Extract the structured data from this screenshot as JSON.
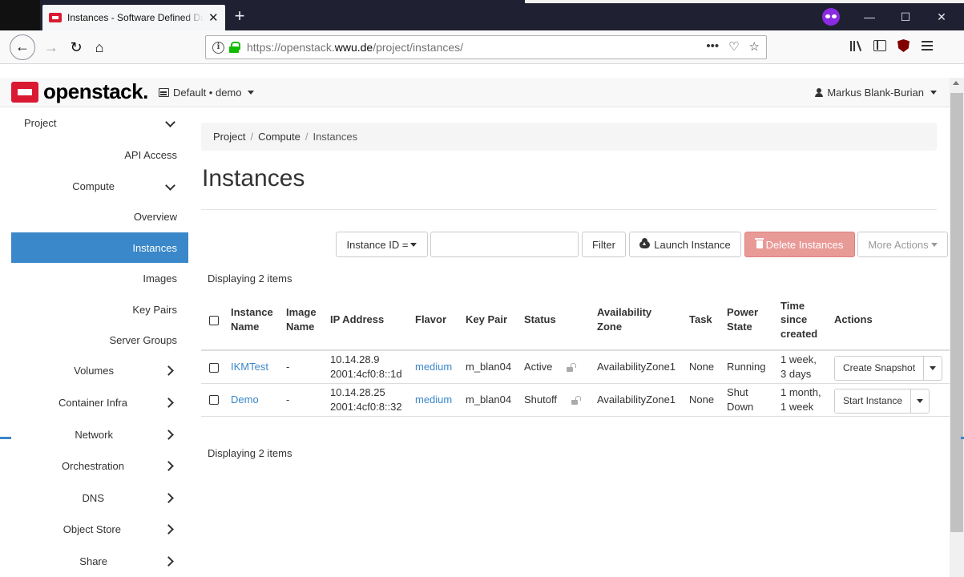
{
  "browser": {
    "tab_title": "Instances - Software Defined Datacenter",
    "tab_close": "✕",
    "new_tab": "+",
    "url_prefix": "https://openstack.",
    "url_domain": "wwu.de",
    "url_path": "/project/instances/",
    "url_more": "•••",
    "window_minimize": "—",
    "window_maximize": "☐",
    "window_close": "✕"
  },
  "header": {
    "logo_text": "openstack.",
    "project_switcher": "Default • demo",
    "user_name": "Markus Blank-Burian"
  },
  "sidebar": {
    "items": [
      {
        "label": "Project",
        "chevron": "down"
      },
      {
        "label": "API Access"
      },
      {
        "label": "Compute",
        "chevron": "down"
      },
      {
        "label": "Overview"
      },
      {
        "label": "Instances",
        "active": true
      },
      {
        "label": "Images"
      },
      {
        "label": "Key Pairs"
      },
      {
        "label": "Server Groups"
      },
      {
        "label": "Volumes",
        "chevron": "right"
      },
      {
        "label": "Container Infra",
        "chevron": "right"
      },
      {
        "label": "Network",
        "chevron": "right"
      },
      {
        "label": "Orchestration",
        "chevron": "right"
      },
      {
        "label": "DNS",
        "chevron": "right"
      },
      {
        "label": "Object Store",
        "chevron": "right"
      },
      {
        "label": "Share",
        "chevron": "right"
      }
    ]
  },
  "breadcrumb": [
    "Project",
    "Compute",
    "Instances"
  ],
  "page_title": "Instances",
  "toolbar": {
    "filter_field": "Instance ID =",
    "filter_value": "",
    "filter_button": "Filter",
    "launch_button": "Launch Instance",
    "delete_button": "Delete Instances",
    "more_button": "More Actions"
  },
  "display_count_top": "Displaying 2 items",
  "display_count_bottom": "Displaying 2 items",
  "table": {
    "headers": {
      "name": [
        "Instance",
        "Name"
      ],
      "image": [
        "Image",
        "Name"
      ],
      "ip": "IP Address",
      "flavor": "Flavor",
      "keypair": "Key Pair",
      "status": "Status",
      "zone": [
        "Availability",
        "Zone"
      ],
      "task": "Task",
      "power": [
        "Power",
        "State"
      ],
      "time": [
        "Time",
        "since",
        "created"
      ],
      "actions": "Actions"
    },
    "rows": [
      {
        "name": "IKMTest",
        "image": "-",
        "ip1": "10.14.28.9",
        "ip2": "2001:4cf0:8::1d",
        "flavor": "medium",
        "keypair": "m_blan04",
        "status": "Active",
        "zone": "AvailabilityZone1",
        "task": "None",
        "power1": "Running",
        "power2": "",
        "time1": "1 week,",
        "time2": "3 days",
        "action": "Create Snapshot"
      },
      {
        "name": "Demo",
        "image": "-",
        "ip1": "10.14.28.25",
        "ip2": "2001:4cf0:8::32",
        "flavor": "medium",
        "keypair": "m_blan04",
        "status": "Shutoff",
        "zone": "AvailabilityZone1",
        "task": "None",
        "power1": "Shut",
        "power2": "Down",
        "time1": "1 month,",
        "time2": "1 week",
        "action": "Start Instance"
      }
    ]
  },
  "colors": {
    "active_nav": "#3a87c9",
    "link": "#3a87c9",
    "danger": "#e89a97",
    "brand": "#da1a32"
  }
}
